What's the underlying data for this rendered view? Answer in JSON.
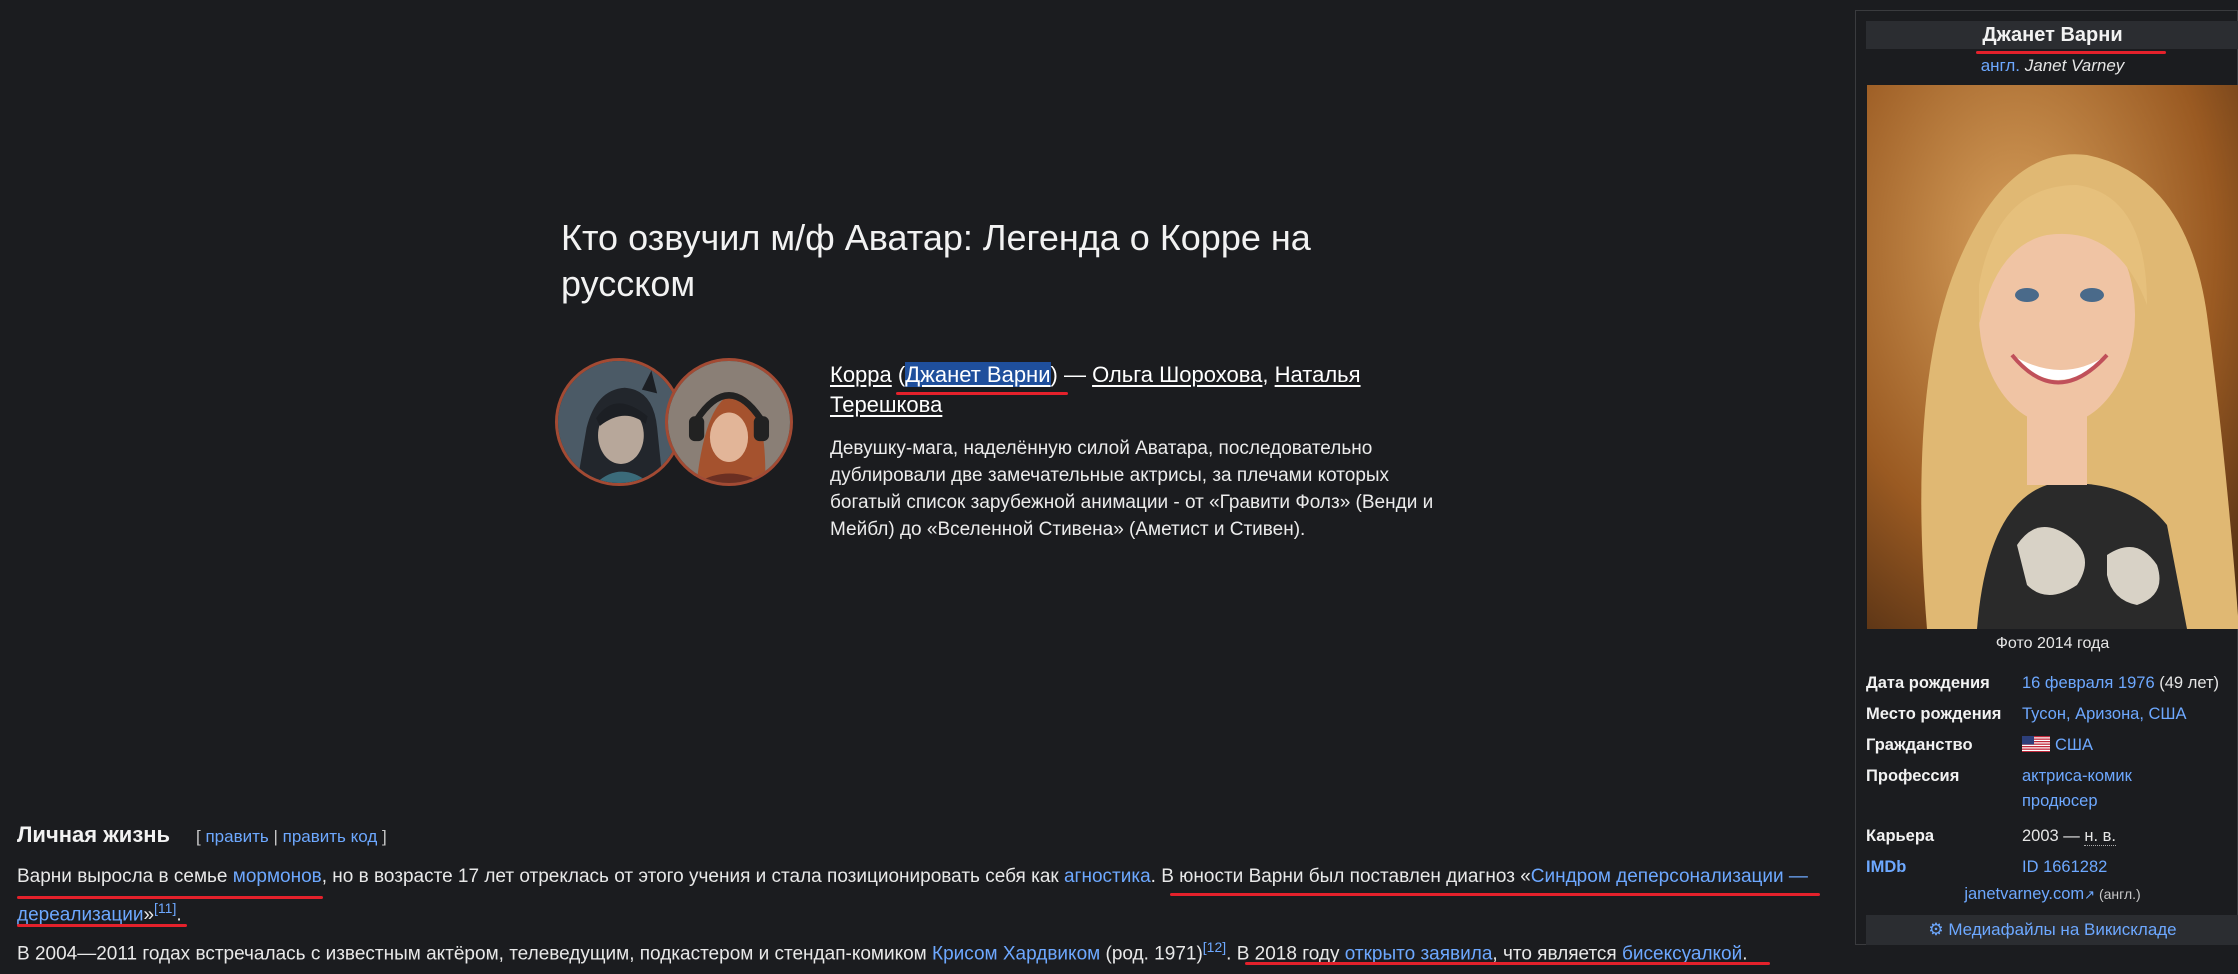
{
  "card": {
    "title": "Кто озвучил м/ф Аватар: Легенда о Корре на русском",
    "cast": {
      "character": "Корра",
      "open_paren": " (",
      "original_actor": "Джанет Варни",
      "close_dash": ") — ",
      "actor1": "Ольга Шорохова",
      "comma": ", ",
      "actor2": "Наталья Терешкова"
    },
    "description": "Девушку-мага, наделённую силой Аватара, последовательно дублировали две замечательные актрисы, за плечами которых богатый список зарубежной анимации - от «Гравити Фолз» (Венди и Мейбл) до «Вселенной Стивена» (Аметист и Стивен)."
  },
  "section": {
    "title": "Личная жизнь",
    "edit_open": "[ ",
    "edit_link": "править",
    "edit_sep": " | ",
    "edit_code": "править код",
    "edit_close": " ]",
    "p1": {
      "t1": "Варни выросла в семье ",
      "l1": "мормонов",
      "t2": ", но в возрасте 17 лет отреклась от этого учения и стала позиционировать себя как ",
      "l2": "агностика",
      "t3": ". В юности Варни был поставлен диагноз «",
      "l3": "Синдром деперсонализации —",
      "l4": "дереализации",
      "t4": "»",
      "ref": "[11]",
      "t5": "."
    },
    "p2": {
      "t1": "В 2004—2011 годах встречалась с известным актёром, телеведущим, подкастером и стендап-комиком ",
      "l1": "Крисом Хардвиком",
      "t2": " (род. 1971)",
      "ref": "[12]",
      "t3": ". В 2018 году ",
      "l2": "открыто заявила",
      "t4": ", что является ",
      "l3": "бисексуалкой",
      "t5": "."
    }
  },
  "infobox": {
    "name": "Джанет Варни",
    "orig_lang": "англ.",
    "orig_name": "Janet Varney",
    "photo_caption": "Фото 2014 года",
    "rows": [
      {
        "label": "Дата рождения",
        "value_link": "16 февраля 1976",
        "value_text": " (49 лет)"
      },
      {
        "label": "Место рождения",
        "value_link": "Тусон, Аризона, США"
      },
      {
        "label": "Гражданство",
        "value_link": "США"
      },
      {
        "label": "Профессия",
        "value_link": "актриса-комик",
        "value_link2": "продюсер"
      },
      {
        "label": "Карьера",
        "value_text": "2003 — ",
        "value_abbr": "н. в."
      },
      {
        "label": "IMDb",
        "value_link": "ID 1661282"
      }
    ],
    "website": "janetvarney.com",
    "website_lang": " (англ.)",
    "commons": "Медиафайлы на Викискладе"
  },
  "colors": {
    "background": "#1b1c1f",
    "link": "#6da8ff",
    "annotation_red": "#e4212b",
    "selection": "#1f4f9c"
  }
}
